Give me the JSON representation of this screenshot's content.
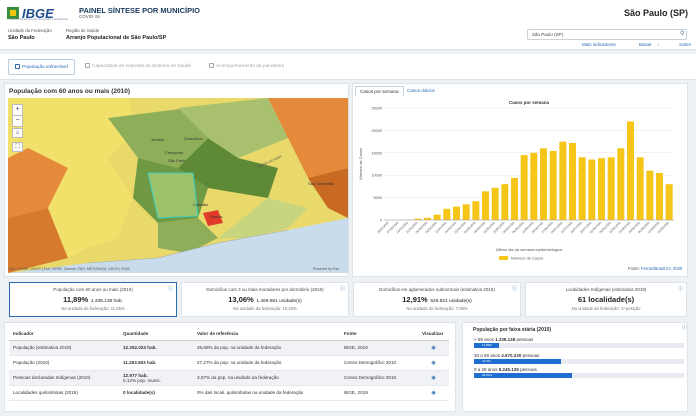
{
  "header": {
    "logo_text": "IBGE",
    "logo_tagline": "Instituto Brasileiro de Geografia e Estatística",
    "title": "PAINEL SÍNTESE POR MUNICÍPIO",
    "subtitle": "COVID-19",
    "uf_label": "Unidade da Federação",
    "uf_value": "São Paulo",
    "region_label": "Região de Saúde",
    "region_value": "Arranjo Populacional de São Paulo/SP",
    "place": "São Paulo (SP)",
    "search_value": "São Paulo (SP)",
    "links": [
      "Mais indicadores",
      "Baixar",
      "Sobre"
    ]
  },
  "tabs": [
    {
      "label": "População vulnerável",
      "active": true
    },
    {
      "label": "Capacidade de resposta do Sistema de Saúde",
      "active": false
    },
    {
      "label": "Acompanhamento da pandemia",
      "active": false
    }
  ],
  "map": {
    "title": "População com 60 anos ou mais (2010)",
    "attribution": "Esri, CGIAR, USGS | Esri, HERE, Garmin, FAO, METI/NASA, USGS | IBGE",
    "powered": "Powered by Esri",
    "labels": [
      "Campinas",
      "Guarulhos",
      "São Paulo",
      "Jundiaí",
      "Cubatão",
      "São Sebastião",
      "Santos",
      "SERRA DO MAR"
    ]
  },
  "chart": {
    "tabs": [
      "Casos por semana",
      "Casos diários"
    ],
    "source_label": "Fonte:",
    "source_link": "Ferrari/Brasil.IO, 2020"
  },
  "chart_data": {
    "type": "bar",
    "title": "Casos por semana",
    "xlabel": "Último dia da semana epidemiológica",
    "ylabel": "Número de Casos",
    "legend": "Número de Casos",
    "ylim": [
      0,
      25000
    ],
    "yticks": [
      0,
      5000,
      10000,
      15000,
      20000,
      25000
    ],
    "categories": [
      "29/02/2020",
      "07/03/2020",
      "14/03/2020",
      "21/03/2020",
      "28/03/2020",
      "04/04/2020",
      "11/04/2020",
      "18/04/2020",
      "25/04/2020",
      "02/05/2020",
      "09/05/2020",
      "16/05/2020",
      "23/05/2020",
      "30/05/2020",
      "06/06/2020",
      "13/06/2020",
      "20/06/2020",
      "27/06/2020",
      "04/07/2020",
      "11/07/2020",
      "18/07/2020",
      "25/07/2020",
      "01/08/2020",
      "08/08/2020",
      "15/08/2020",
      "22/08/2020",
      "29/08/2020",
      "05/09/2020",
      "12/09/2020",
      "19/09/2020"
    ],
    "values": [
      0,
      0,
      50,
      300,
      500,
      1200,
      2500,
      3000,
      3500,
      4200,
      6400,
      7200,
      8000,
      9400,
      14500,
      15000,
      16000,
      15400,
      17500,
      17200,
      14000,
      13500,
      13800,
      14000,
      16000,
      22000,
      14000,
      11000,
      10500,
      8000
    ]
  },
  "kpis": [
    {
      "title": "População com 60 anos ou mais (2010)",
      "value": "11,89%",
      "extra": "1.338.138 hab.",
      "note": "Na unidade da federação: 11,55%"
    },
    {
      "title": "Domicílios com 3 ou mais moradores por dormitório (2010)",
      "value": "13,06%",
      "extra": "1.469.981 unidade(s)",
      "note": "Na unidade da federação: 10,42%"
    },
    {
      "title": "Domicílios em aglomerados subnormais (estimativa 2019)",
      "value": "12,91%",
      "extra": "529.921 unidade(s)",
      "note": "Na unidade da federação: 7,09%"
    },
    {
      "title": "Localidades Indígenas (estimativa 2019)",
      "value": "61 localidade(s)",
      "extra": "",
      "note": "Na unidade da federação: 1ª posição"
    }
  ],
  "table": {
    "headers": [
      "Indicador",
      "Quantidade",
      "Valor de referência",
      "Fonte",
      "Visualizar"
    ],
    "rows": [
      {
        "ind": "População (estimativa 2019)",
        "qty": "12.252.023 hab.",
        "qty2": "",
        "ref": "26,68% da pop. na unidade da federação",
        "src": "IBGE, 2019"
      },
      {
        "ind": "População (2010)",
        "qty": "11.253.503 hab.",
        "qty2": "",
        "ref": "27,27% da pop. na unidade da federação",
        "src": "Censo Demográfico 2010"
      },
      {
        "ind": "Pessoas declaradas Indígenas (2010)",
        "qty": "12.977 hab.",
        "qty2": "0,12% pop. munic.",
        "ref": "3,07% da pop. na unidade da federação",
        "src": "Censo Demográfico 2010"
      },
      {
        "ind": "Localidades quilombolas (2019)",
        "qty": "0 localidade(s)",
        "qty2": "",
        "ref": "0% das locali. quilombolas na unidade da federação",
        "src": "IBGE, 2019"
      }
    ]
  },
  "age": {
    "title": "População por faixa etária (2010)",
    "groups": [
      {
        "label": "> 59 anos",
        "value": "1.338.138",
        "unit": "pessoas",
        "pct": "11,89%",
        "fraction": 0.1189
      },
      {
        "label": "30 a 59 anos",
        "value": "4.670.230",
        "unit": "pessoas",
        "pct": "41,5%",
        "fraction": 0.415
      },
      {
        "label": "0 a 29 anos",
        "value": "5.245.135",
        "unit": "pessoas",
        "pct": "46,61%",
        "fraction": 0.4661
      }
    ]
  },
  "colors": {
    "accent": "#2a6bb0",
    "bar": "#f5c518",
    "map_green": "#6f9a43",
    "map_yellow": "#f1e16b",
    "map_orange": "#e48a3a"
  }
}
